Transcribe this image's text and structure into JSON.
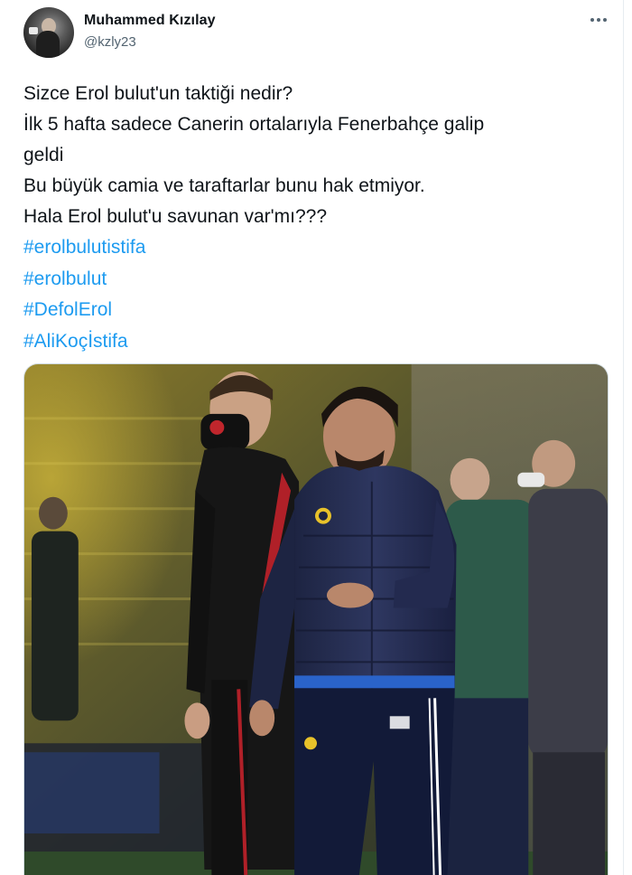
{
  "author": {
    "display_name": "Muhammed Kızılay",
    "handle": "@kzly23"
  },
  "tweet": {
    "lines": [
      "Sizce Erol bulut'un taktiği nedir?",
      "İlk 5 hafta sadece Canerin ortalarıyla Fenerbahçe galip",
      "geldi",
      "Bu büyük camia ve taraftarlar bunu hak etmiyor.",
      "Hala Erol bulut'u savunan var'mı???"
    ],
    "hashtags": [
      "#erolbulutistifa",
      "#erolbulut",
      "#DefolErol",
      "#AliKoçİstifa"
    ]
  },
  "icons": {
    "more": "more-options-icon"
  },
  "colors": {
    "text": "#0f1419",
    "secondary": "#536471",
    "link": "#1d9bf0",
    "background": "#ffffff"
  }
}
